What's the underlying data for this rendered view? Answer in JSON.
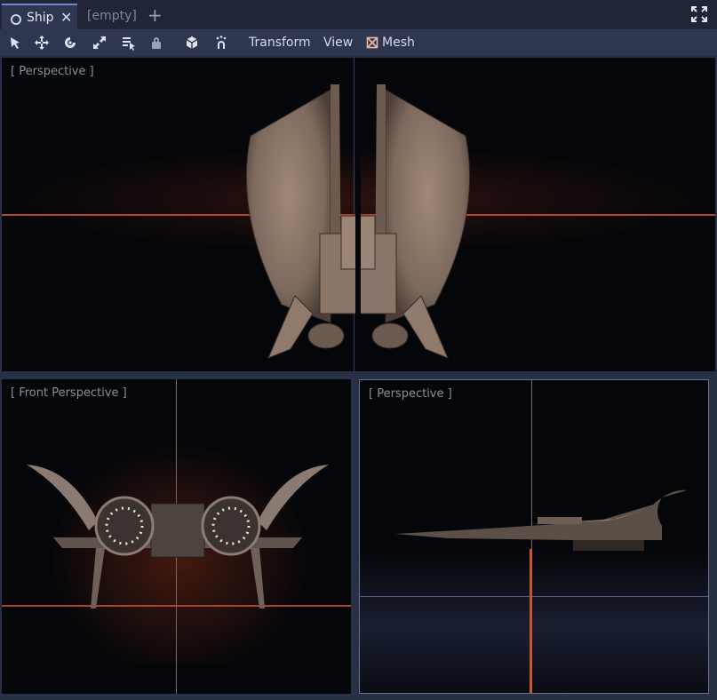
{
  "tabs": [
    {
      "label": "Ship",
      "active": true
    },
    {
      "label": "[empty]",
      "active": false
    }
  ],
  "add_tab_glyph": "+",
  "close_glyph": "✕",
  "toolbar": {
    "tools": [
      "select-icon",
      "move-icon",
      "rotate-icon",
      "scale-icon",
      "list-select-icon",
      "lock-icon",
      "local-space-icon",
      "snap-icon"
    ],
    "menus": {
      "transform": "Transform",
      "view": "View",
      "mesh": "Mesh"
    }
  },
  "viewports": {
    "top": {
      "label": "[ Perspective ]"
    },
    "front": {
      "label": "[ Front Perspective ]"
    },
    "side": {
      "label": "[ Perspective ]"
    }
  },
  "colors": {
    "background": "#283046",
    "tabbar": "#202637",
    "toolbar": "#2e3650",
    "viewport": "#05060a",
    "accent_glow": "#c8542a"
  }
}
